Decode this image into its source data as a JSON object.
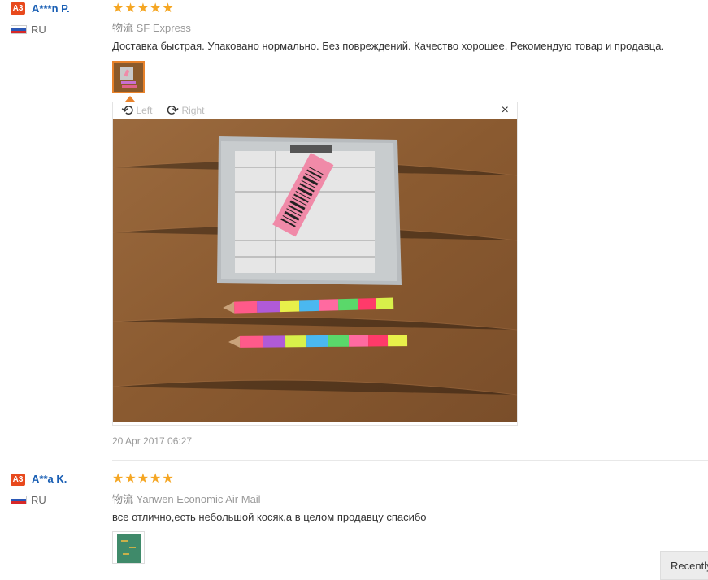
{
  "reviews": [
    {
      "badge": "A3",
      "username": "A***n P.",
      "country": "RU",
      "stars": "★★★★★",
      "shipping_label": "物流",
      "shipping_method": "SF Express",
      "comment": "Доставка быстрая. Упаковано нормально. Без повреждений. Качество хорошее. Рекомендую товар и продавца.",
      "date": "20 Apr 2017 06:27"
    },
    {
      "badge": "A3",
      "username": "A**a K.",
      "country": "RU",
      "stars": "★★★★★",
      "shipping_label": "物流",
      "shipping_method": "Yanwen Economic Air Mail",
      "comment": "все отлично,есть небольшой косяк,а в целом продавцу спасибо"
    }
  ],
  "viewer": {
    "rotate_left_label": "Left",
    "rotate_right_label": "Right",
    "close_symbol": "×",
    "rotate_left_icon": "rotate-left-icon",
    "rotate_right_icon": "rotate-right-icon"
  },
  "recent_button_label": "Recently",
  "colors": {
    "badge": "#e8491d",
    "username": "#1a5fb4",
    "stars": "#f5a623",
    "thumb_border_active": "#e8822a"
  }
}
